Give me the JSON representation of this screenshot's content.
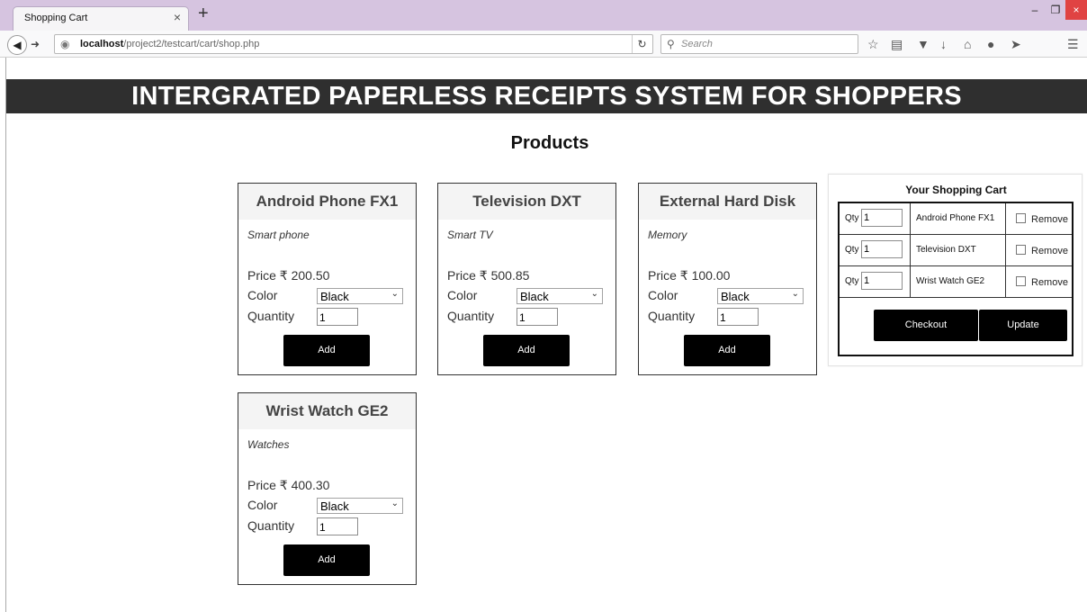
{
  "browser": {
    "tab_title": "Shopping Cart",
    "tab_close": "×",
    "new_tab": "+",
    "url_host": "localhost",
    "url_path": "/project2/testcart/cart/shop.php",
    "search_placeholder": "Search",
    "window_controls": {
      "minimize": "–",
      "maximize": "❐",
      "close": "×"
    }
  },
  "header": {
    "banner": "INTERGRATED PAPERLESS RECEIPTS SYSTEM FOR SHOPPERS",
    "products_title": "Products"
  },
  "products": [
    {
      "name": "Android Phone FX1",
      "desc": "Smart phone",
      "price": "Price ₹ 200.50",
      "color_label": "Color",
      "color_value": "Black",
      "qty_label": "Quantity",
      "qty_value": "1",
      "add_label": "Add"
    },
    {
      "name": "Television DXT",
      "desc": "Smart TV",
      "price": "Price ₹ 500.85",
      "color_label": "Color",
      "color_value": "Black",
      "qty_label": "Quantity",
      "qty_value": "1",
      "add_label": "Add"
    },
    {
      "name": "External Hard Disk",
      "desc": "Memory",
      "price": "Price ₹ 100.00",
      "color_label": "Color",
      "color_value": "Black",
      "qty_label": "Quantity",
      "qty_value": "1",
      "add_label": "Add"
    },
    {
      "name": "Wrist Watch GE2",
      "desc": "Watches",
      "price": "Price ₹ 400.30",
      "color_label": "Color",
      "color_value": "Black",
      "qty_label": "Quantity",
      "qty_value": "1",
      "add_label": "Add"
    }
  ],
  "cart": {
    "title": "Your Shopping Cart",
    "qty_label": "Qty",
    "remove_label": "Remove",
    "items": [
      {
        "qty": "1",
        "name": "Android Phone FX1"
      },
      {
        "qty": "1",
        "name": "Television DXT"
      },
      {
        "qty": "1",
        "name": "Wrist Watch GE2"
      }
    ],
    "checkout_label": "Checkout",
    "update_label": "Update"
  }
}
